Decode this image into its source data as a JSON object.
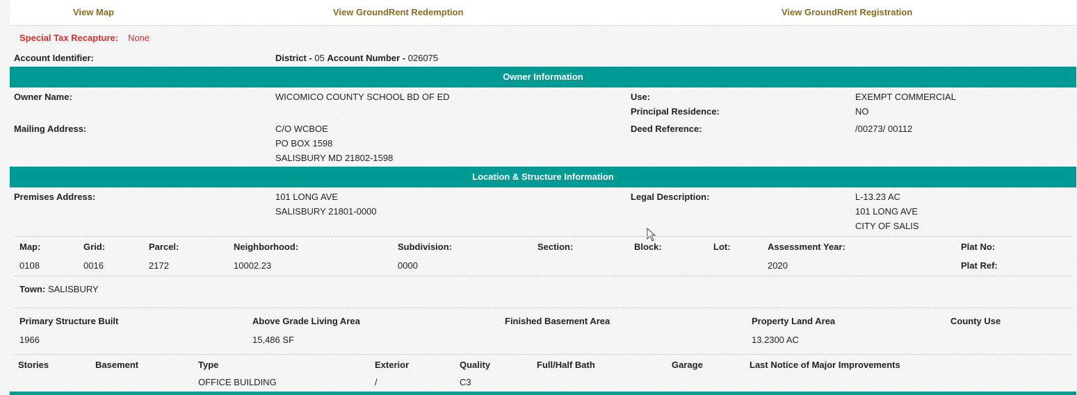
{
  "links": {
    "view_map": "View Map",
    "view_redemption": "View GroundRent Redemption",
    "view_registration": "View GroundRent Registration"
  },
  "special_tax": {
    "label": "Special Tax Recapture:",
    "value": "None"
  },
  "account": {
    "label": "Account Identifier:",
    "district_label": "District -",
    "district_value": "05",
    "account_number_label": "Account Number -",
    "account_number_value": "026075"
  },
  "owner_section": {
    "title": "Owner Information",
    "owner_name_label": "Owner Name:",
    "owner_name_value": "WICOMICO COUNTY SCHOOL BD OF ED",
    "use_label": "Use:",
    "use_value": "EXEMPT COMMERCIAL",
    "principal_label": "Principal Residence:",
    "principal_value": "NO",
    "mailing_label": "Mailing Address:",
    "mailing_lines": [
      "C/O WCBOE",
      "PO BOX 1598",
      "SALISBURY MD 21802-1598"
    ],
    "deed_label": "Deed Reference:",
    "deed_value": "/00273/ 00112"
  },
  "location_section": {
    "title": "Location & Structure Information",
    "premises_label": "Premises Address:",
    "premises_lines": [
      "101 LONG AVE",
      "SALISBURY 21801-0000"
    ],
    "legal_label": "Legal Description:",
    "legal_lines": [
      "L-13.23 AC",
      "101 LONG AVE",
      "CITY OF SALIS"
    ]
  },
  "parcel_table": {
    "headers": [
      "Map:",
      "Grid:",
      "Parcel:",
      "Neighborhood:",
      "Subdivision:",
      "Section:",
      "Block:",
      "Lot:",
      "Assessment Year:",
      "Plat No:"
    ],
    "values": [
      "0108",
      "0016",
      "2172",
      "10002.23",
      "0000",
      "",
      "",
      "",
      "2020",
      ""
    ],
    "plat_ref_label": "Plat Ref:"
  },
  "town": {
    "label": "Town:",
    "value": "SALISBURY"
  },
  "structure_table": {
    "headers": [
      "Primary Structure Built",
      "Above Grade Living Area",
      "Finished Basement Area",
      "Property Land Area",
      "County Use"
    ],
    "values": [
      "1966",
      "15,486 SF",
      "",
      "13.2300 AC",
      ""
    ]
  },
  "building_table": {
    "headers": [
      "Stories",
      "Basement",
      "Type",
      "Exterior",
      "Quality",
      "Full/Half Bath",
      "Garage",
      "Last Notice of Major Improvements"
    ],
    "values": [
      "",
      "",
      "OFFICE BUILDING",
      "/",
      "C3",
      "",
      "",
      ""
    ]
  },
  "colors": {
    "band": "#009a94",
    "link": "#8a6d1a",
    "special": "#d32f2f"
  },
  "icons": {
    "cursor": "mouse-pointer-icon"
  }
}
